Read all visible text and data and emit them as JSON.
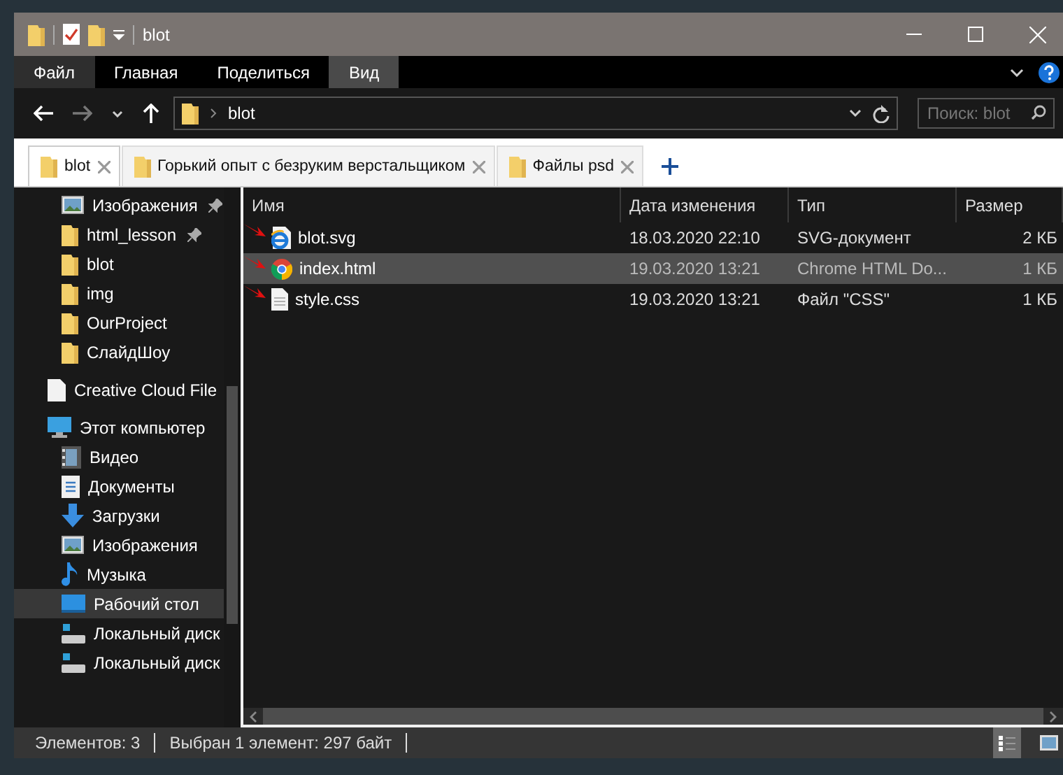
{
  "window": {
    "title": "blot"
  },
  "ribbon_tabs": [
    {
      "label": "Файл",
      "kind": "file",
      "selected": false
    },
    {
      "label": "Главная",
      "kind": "tab",
      "selected": false
    },
    {
      "label": "Поделиться",
      "kind": "tab",
      "selected": false
    },
    {
      "label": "Вид",
      "kind": "tab",
      "selected": true
    }
  ],
  "address": {
    "path": [
      "blot"
    ],
    "search_placeholder": "Поиск: blot"
  },
  "folder_tabs": [
    {
      "label": "blot",
      "selected": true
    },
    {
      "label": "Горький опыт с безруким верстальщиком",
      "selected": false
    },
    {
      "label": "Файлы psd",
      "selected": false
    }
  ],
  "sidebar": {
    "quick_access": [
      {
        "label": "Изображения",
        "kind": "pictures",
        "pinned": true
      },
      {
        "label": "html_lesson",
        "kind": "folder",
        "pinned": true
      },
      {
        "label": "blot",
        "kind": "folder",
        "pinned": false
      },
      {
        "label": "img",
        "kind": "folder",
        "pinned": false
      },
      {
        "label": "OurProject",
        "kind": "folder",
        "pinned": false
      },
      {
        "label": "СлайдШоу",
        "kind": "folder",
        "pinned": false
      }
    ],
    "items": [
      {
        "label": "Creative Cloud File",
        "kind": "cloud",
        "selected": false
      },
      {
        "label": "Этот компьютер",
        "kind": "computer",
        "selected": false,
        "children": [
          {
            "label": "Видео",
            "kind": "video",
            "selected": false
          },
          {
            "label": "Документы",
            "kind": "documents",
            "selected": false
          },
          {
            "label": "Загрузки",
            "kind": "downloads",
            "selected": false
          },
          {
            "label": "Изображения",
            "kind": "pictures",
            "selected": false
          },
          {
            "label": "Музыка",
            "kind": "music",
            "selected": false
          },
          {
            "label": "Рабочий стол",
            "kind": "desktop",
            "selected": true
          },
          {
            "label": "Локальный диск",
            "kind": "drive",
            "selected": false
          },
          {
            "label": "Локальный диск",
            "kind": "drive",
            "selected": false
          }
        ]
      }
    ]
  },
  "files": {
    "columns": [
      "Имя",
      "Дата изменения",
      "Тип",
      "Размер"
    ],
    "rows": [
      {
        "name": "blot.svg",
        "kind": "svg",
        "date": "18.03.2020 22:10",
        "type": "SVG-документ",
        "size": "2 КБ",
        "selected": false
      },
      {
        "name": "index.html",
        "kind": "html",
        "date": "19.03.2020 13:21",
        "type": "Chrome HTML Do...",
        "size": "1 КБ",
        "selected": true
      },
      {
        "name": "style.css",
        "kind": "text",
        "date": "19.03.2020 13:21",
        "type": "Файл \"CSS\"",
        "size": "1 КБ",
        "selected": false
      }
    ]
  },
  "status_bar": {
    "items": [
      "Элементов: 3",
      "Выбран 1 элемент: 297 байт"
    ],
    "view_modes": [
      {
        "kind": "details",
        "selected": true
      },
      {
        "kind": "thumbnails",
        "selected": false
      }
    ]
  }
}
